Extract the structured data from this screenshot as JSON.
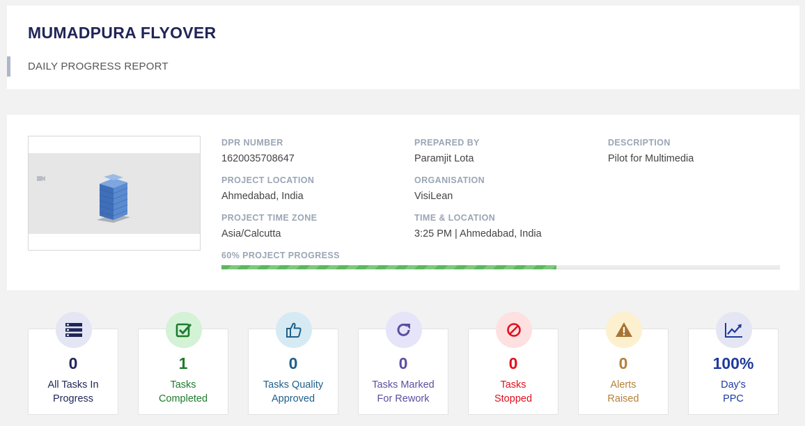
{
  "header": {
    "title": "MUMADPURA FLYOVER",
    "subtitle": "DAILY PROGRESS REPORT"
  },
  "info": {
    "dpr_number": {
      "label": "DPR NUMBER",
      "value": "1620035708647"
    },
    "project_location": {
      "label": "PROJECT LOCATION",
      "value": "Ahmedabad, India"
    },
    "project_time_zone": {
      "label": "PROJECT TIME ZONE",
      "value": "Asia/Calcutta"
    },
    "prepared_by": {
      "label": "PREPARED BY",
      "value": "Paramjit Lota"
    },
    "organisation": {
      "label": "ORGANISATION",
      "value": "VisiLean"
    },
    "time_location": {
      "label": "TIME & LOCATION",
      "value": "3:25 PM | Ahmedabad, India"
    },
    "description": {
      "label": "DESCRIPTION",
      "value": "Pilot for Multimedia"
    }
  },
  "progress": {
    "label": "60% PROJECT PROGRESS",
    "fraction": 0.6,
    "color": "#5cb85c"
  },
  "cards": [
    {
      "value": "0",
      "line1": "All Tasks In",
      "line2": "Progress",
      "icon": "list-icon",
      "color": "#1f2558",
      "badge_bg": "#e4e6f3"
    },
    {
      "value": "1",
      "line1": "Tasks",
      "line2": "Completed",
      "icon": "checkbox-icon",
      "color": "#1e7b2e",
      "badge_bg": "#d3f2d6"
    },
    {
      "value": "0",
      "line1": "Tasks Quality",
      "line2": "Approved",
      "icon": "thumbs-up-icon",
      "color": "#1e5f8a",
      "badge_bg": "#d6eaf3"
    },
    {
      "value": "0",
      "line1": "Tasks Marked",
      "line2": "For Rework",
      "icon": "redo-icon",
      "color": "#5a4fa0",
      "badge_bg": "#e6e4f8"
    },
    {
      "value": "0",
      "line1": "Tasks",
      "line2": "Stopped",
      "icon": "ban-icon",
      "color": "#e0101e",
      "badge_bg": "#fde0e0"
    },
    {
      "value": "0",
      "line1": "Alerts",
      "line2": "Raised",
      "icon": "warning-icon",
      "color": "#b5803a",
      "badge_bg": "#fdf0cf"
    },
    {
      "value": "100%",
      "line1": "Day's",
      "line2": "PPC",
      "icon": "line-chart-icon",
      "color": "#1f3a9e",
      "badge_bg": "#e4e6f3"
    }
  ]
}
